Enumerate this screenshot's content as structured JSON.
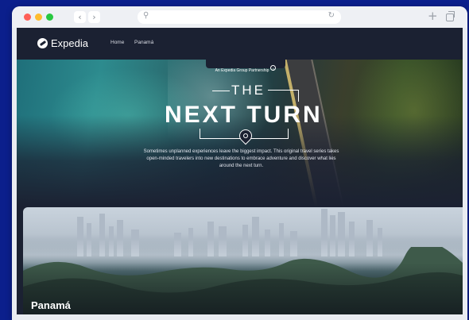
{
  "site": {
    "logo_text": "Expedia",
    "nav": {
      "home": "Home",
      "panama": "Panamá"
    }
  },
  "hero": {
    "badge": "An Expedia Group Partnership",
    "badge_icon": "i",
    "title_small": "THE",
    "title_main": "NEXT TURN",
    "tagline": "Sometimes unplanned experiences leave the biggest impact. This original travel series takes open-minded travelers into new destinations to embrace adventure and discover what lies around the next turn."
  },
  "card": {
    "title": "Panamá"
  },
  "browser": {
    "back": "‹",
    "forward": "›",
    "new_tab": "+",
    "search_icon": "⚲",
    "reload_icon": "↻"
  },
  "colors": {
    "background": "#0b1f8c",
    "nav": "#1b2132"
  }
}
